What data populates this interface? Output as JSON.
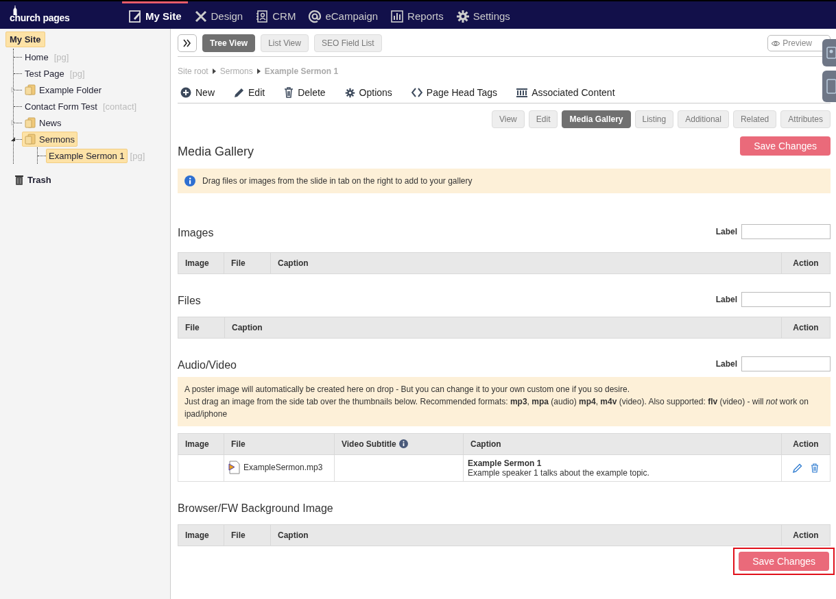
{
  "brand": "church pages",
  "nav": [
    {
      "label": "My Site",
      "selected": true
    },
    {
      "label": "Design",
      "selected": false
    },
    {
      "label": "CRM",
      "selected": false
    },
    {
      "label": "eCampaign",
      "selected": false
    },
    {
      "label": "Reports",
      "selected": false
    },
    {
      "label": "Settings",
      "selected": false
    }
  ],
  "tree": {
    "label": "My Site",
    "selected": true,
    "children": [
      {
        "label": "Home",
        "tag": "[pg]",
        "kind": "page",
        "selected": false
      },
      {
        "label": "Test Page",
        "tag": "[pg]",
        "kind": "page",
        "selected": false
      },
      {
        "label": "Example Folder",
        "kind": "folder",
        "expanded": false,
        "selected": false
      },
      {
        "label": "Contact Form Test",
        "tag": "[contact]",
        "kind": "page",
        "selected": false
      },
      {
        "label": "News",
        "kind": "folder",
        "expanded": false,
        "selected": false
      },
      {
        "label": "Sermons",
        "kind": "folder",
        "expanded": true,
        "selected": true,
        "children": [
          {
            "label": "Example Sermon 1",
            "tag": "[pg]",
            "selected": true
          }
        ]
      }
    ]
  },
  "trash": "Trash",
  "view_buttons": [
    {
      "label": "Tree View",
      "selected": true
    },
    {
      "label": "List View",
      "selected": false
    },
    {
      "label": "SEO Field List",
      "selected": false
    }
  ],
  "preview": "Preview",
  "breadcrumb": [
    "Site root",
    "Sermons",
    "Example Sermon 1"
  ],
  "actions": [
    "New",
    "Edit",
    "Delete",
    "Options",
    "Page Head Tags",
    "Associated Content"
  ],
  "tabs": [
    {
      "label": "View",
      "selected": false
    },
    {
      "label": "Edit",
      "selected": false
    },
    {
      "label": "Media Gallery",
      "selected": true
    },
    {
      "label": "Listing",
      "selected": false
    },
    {
      "label": "Additional",
      "selected": false
    },
    {
      "label": "Related",
      "selected": false
    },
    {
      "label": "Attributes",
      "selected": false
    }
  ],
  "title": "Media Gallery",
  "save_top": "Save Changes",
  "info": "Drag files or images from the slide in tab on the right to add to your gallery",
  "sections": [
    {
      "title": "Images",
      "label_field": "Label",
      "columns": [
        "Image",
        "File",
        "Caption",
        "Action"
      ]
    },
    {
      "title": "Files",
      "label_field": "Label",
      "columns": [
        "File",
        "Caption",
        "Action"
      ]
    },
    {
      "title": "Audio/Video",
      "label_field": "Label",
      "note": [
        "A poster image will automatically be created here on drop - But you can change it to your own custom one if you so desire.",
        "Just drag an image from the side tab over the thumbnails below. Recommended formats: **mp3**, **mpa** (audio) **mp4**, **m4v** (video). Also supported: **flv** (video) - will *not* work on ipad/iphone"
      ],
      "columns": [
        "Image",
        "File",
        "Video Subtitle",
        "Caption",
        "Action"
      ],
      "rows": [
        {
          "file": "ExampleSermon.mp3",
          "caption_title": "Example Sermon 1",
          "caption": "Example speaker 1 talks about the example topic."
        }
      ]
    },
    {
      "title": "Browser/FW Background Image",
      "columns": [
        "Image",
        "File",
        "Caption",
        "Action"
      ]
    }
  ],
  "save_bottom": {
    "label": "Save Changes",
    "highlighted": true
  }
}
